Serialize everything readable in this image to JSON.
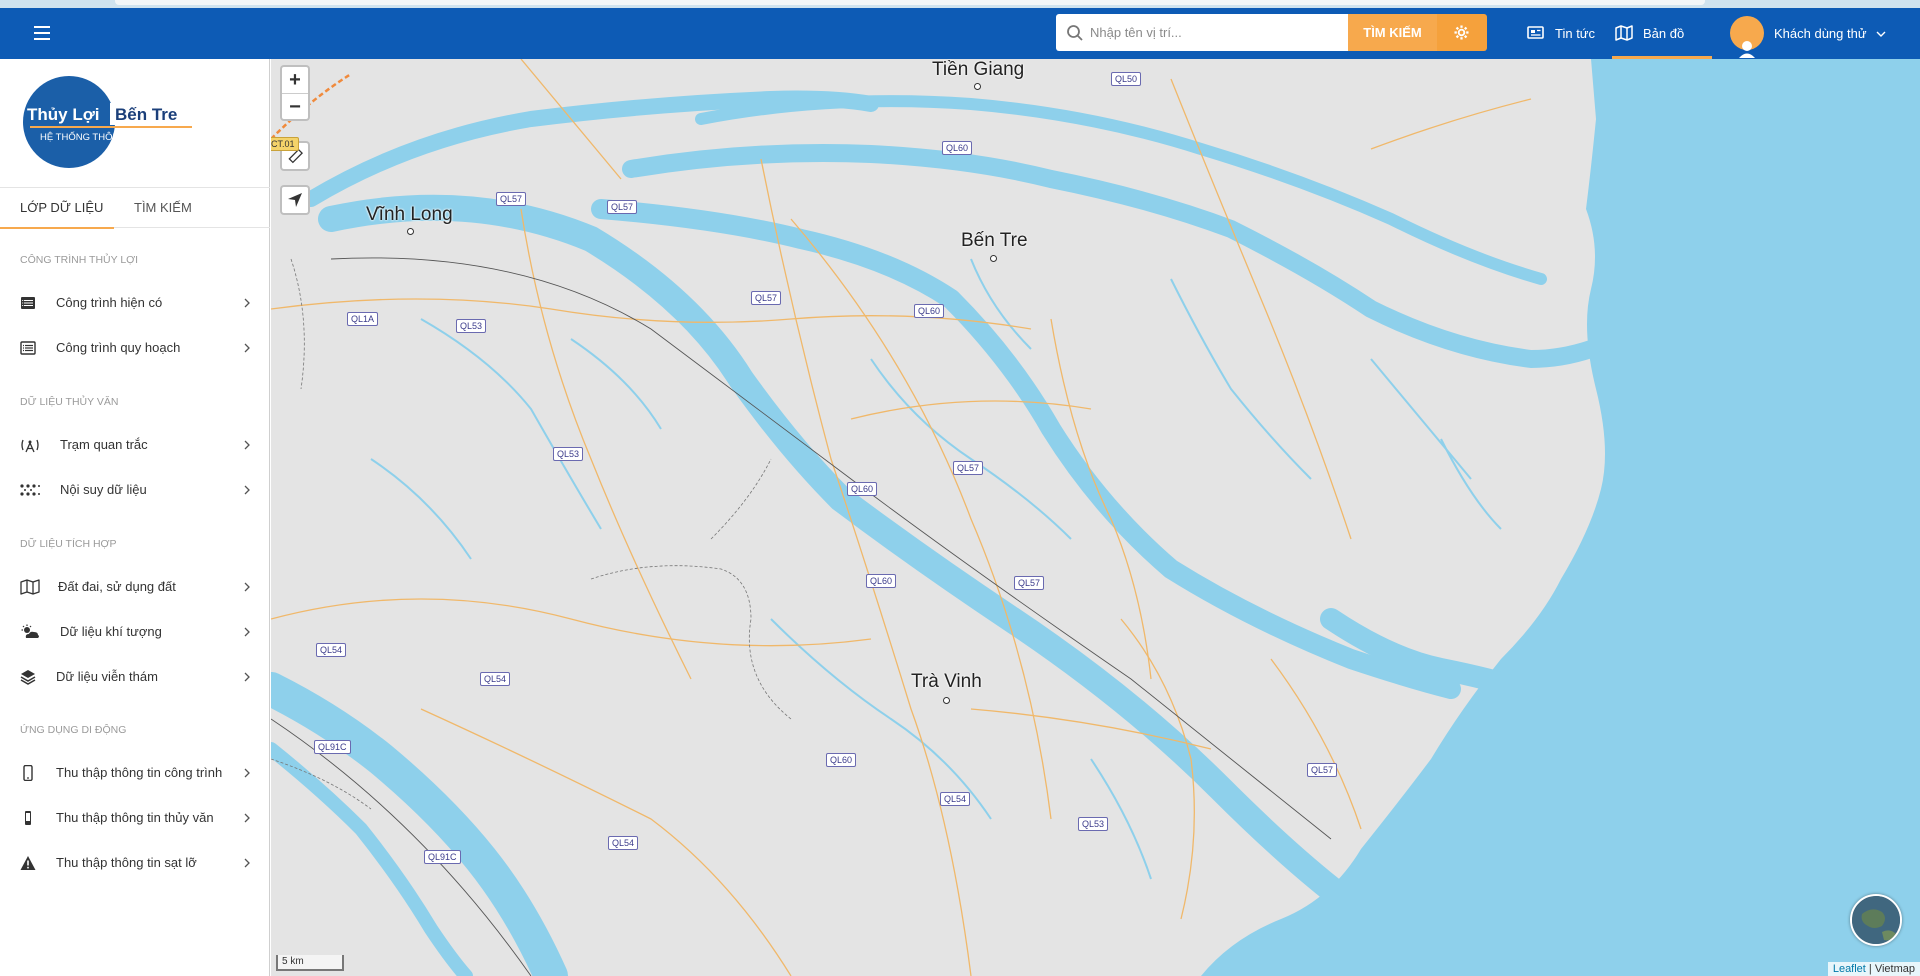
{
  "header": {
    "search_placeholder": "Nhập tên vị trí...",
    "search_button": "TÌM KIẾM",
    "nav": {
      "news": "Tin tức",
      "map": "Bản đồ",
      "user": "Khách dùng thử"
    },
    "accent": "#f7a94d",
    "brand": "#0d5bb5"
  },
  "sidebar": {
    "logo": {
      "title": "Thủy Lợi",
      "title2": "Bến Tre",
      "subtitle": "HỆ THỐNG THÔNG TIN"
    },
    "tabs": [
      "LỚP DỮ LIỆU",
      "TÌM KIẾM"
    ],
    "sections": [
      {
        "title": "CÔNG TRÌNH THỦY LỢI",
        "items": [
          {
            "label": "Công trình hiện có",
            "icon": "list-icon"
          },
          {
            "label": "Công trình quy hoạch",
            "icon": "list-detail-icon"
          }
        ]
      },
      {
        "title": "DỮ LIỆU THỦY VĂN",
        "items": [
          {
            "label": "Trạm quan trắc",
            "icon": "antenna-icon"
          },
          {
            "label": "Nội suy dữ liệu",
            "icon": "dots-grid-icon"
          }
        ]
      },
      {
        "title": "DỮ LIỆU TÍCH HỢP",
        "items": [
          {
            "label": "Đất đai, sử dụng đất",
            "icon": "map-icon"
          },
          {
            "label": "Dữ liệu khí tượng",
            "icon": "weather-icon"
          },
          {
            "label": "Dữ liệu viễn thám",
            "icon": "layers-icon"
          }
        ]
      },
      {
        "title": "ỨNG DỤNG DI ĐỘNG",
        "items": [
          {
            "label": "Thu thập thông tin công trình",
            "icon": "mobile-icon"
          },
          {
            "label": "Thu thập thông tin thủy văn",
            "icon": "mobile-small-icon"
          },
          {
            "label": "Thu thập thông tin sạt lỡ",
            "icon": "warning-icon"
          }
        ]
      }
    ]
  },
  "map": {
    "zoom_in": "+",
    "zoom_out": "−",
    "cities": [
      "Tiền Giang",
      "Bến Tre",
      "Vĩnh Long",
      "Trà Vinh"
    ],
    "roads": [
      "QL50",
      "QL60",
      "QL57",
      "QL57",
      "QL1A",
      "QL53",
      "QL57",
      "QL60",
      "QL53",
      "QL60",
      "QL57",
      "QL60",
      "QL57",
      "QL54",
      "QL54",
      "QL91C",
      "QL60",
      "QL54",
      "QL54",
      "QL91C",
      "QL53",
      "QL57",
      "CT.01"
    ],
    "scale": "5 km",
    "attribution": {
      "leaflet": "Leaflet",
      "provider": "Vietmap"
    },
    "colors": {
      "land": "#e4e4e4",
      "water": "#8ed0eb",
      "road": "#f0b86a"
    }
  }
}
